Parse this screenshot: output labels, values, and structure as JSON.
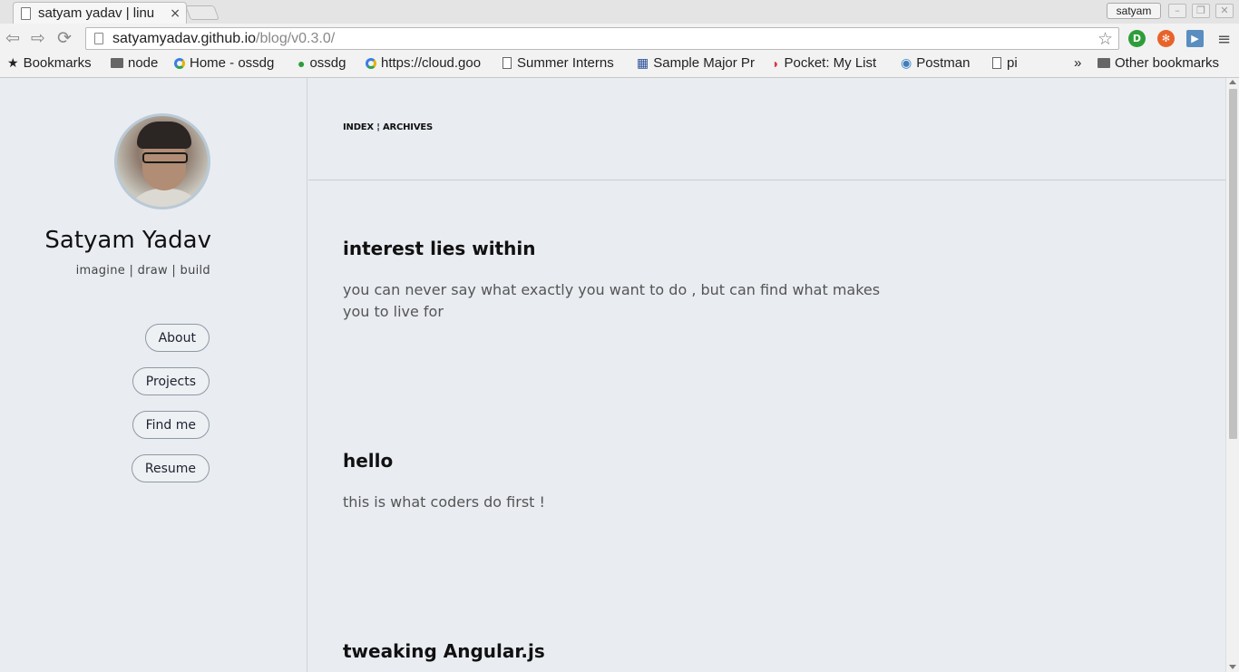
{
  "browser": {
    "tab_title": "satyam yadav | linu",
    "tab_close": "×",
    "user": "satyam",
    "url_host": "satyamyadav.github.io",
    "url_path": "/blog/v0.3.0/",
    "back_icon": "back-arrow-icon",
    "forward_icon": "forward-arrow-icon",
    "reload_icon": "reload-icon",
    "star_icon": "bookmark-star-icon",
    "extensions": [
      {
        "name": "ext-green-icon",
        "glyph": "D",
        "color": "#2e9d3a"
      },
      {
        "name": "ext-orange-icon",
        "glyph": "✻",
        "color": "#e8632a"
      },
      {
        "name": "ext-cast-icon",
        "glyph": "▶",
        "color": "#5a8ec0"
      }
    ],
    "menu_glyph": "≡",
    "win_buttons": [
      "–",
      "❐",
      "✕"
    ]
  },
  "bookmarks": {
    "items": [
      {
        "label": "Bookmarks",
        "type": "star"
      },
      {
        "label": "node",
        "type": "folder"
      },
      {
        "label": "Home - ossdg",
        "type": "goog"
      },
      {
        "label": "ossdg",
        "type": "dot"
      },
      {
        "label": "https://cloud.goo",
        "type": "goog"
      },
      {
        "label": "Summer Interns",
        "type": "doc"
      },
      {
        "label": "Sample Major Pr",
        "type": "grid"
      },
      {
        "label": "Pocket: My List",
        "type": "pocket"
      },
      {
        "label": "Postman",
        "type": "globe"
      },
      {
        "label": "pi",
        "type": "doc"
      }
    ],
    "overflow": "»",
    "other": "Other bookmarks"
  },
  "sidebar": {
    "name": "Satyam Yadav",
    "tagline": "imagine | draw | build",
    "nav": [
      "About",
      "Projects",
      "Find me",
      "Resume"
    ]
  },
  "main": {
    "crumbs": "INDEX ¦ ARCHIVES",
    "posts": [
      {
        "title": "interest lies within",
        "excerpt": "you can never say what exactly you want to do , but can find what makes you to live for"
      },
      {
        "title": "hello",
        "excerpt": "this is what coders do first !"
      },
      {
        "title": "tweaking Angular.js",
        "excerpt": ""
      }
    ]
  }
}
